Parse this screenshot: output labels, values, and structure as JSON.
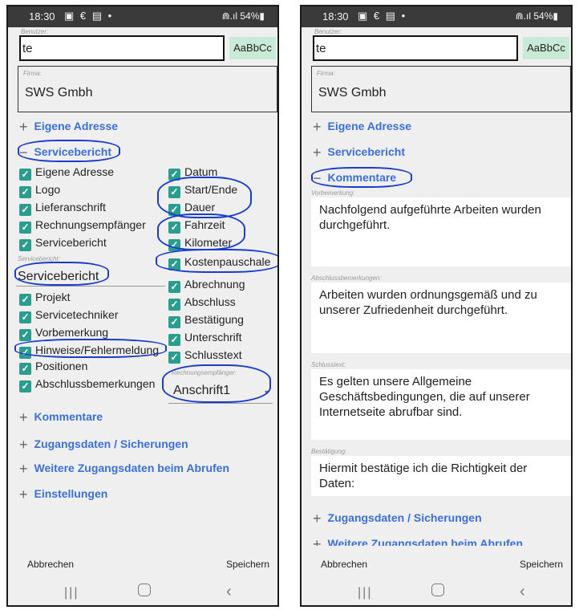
{
  "status": {
    "time": "18:30",
    "icons": "▣ € ▤ •",
    "battery": "⋒.ıl 54%▮"
  },
  "header": {
    "user_label": "Benutzer:",
    "user_value": "te",
    "style_button": "AaBbCc",
    "firma_label": "Firma:",
    "firma_value": "SWS Gmbh"
  },
  "screen1": {
    "sections": {
      "eigene": "Eigene Adresse",
      "servicebericht": "Servicebericht",
      "kommentare": "Kommentare",
      "zugang": "Zugangsdaten / Sicherungen",
      "weitere": "Weitere Zugangsdaten beim Abrufen",
      "einstellungen": "Einstellungen"
    },
    "left_checks": [
      "Eigene Adresse",
      "Logo",
      "Lieferanschrift",
      "Rechnungsempfänger",
      "Servicebericht"
    ],
    "servicebericht_label": "Servicebericht:",
    "servicebericht_value": "Servicebericht",
    "left_checks2": [
      "Projekt",
      "Servicetechniker",
      "Vorbemerkung",
      "Hinweise/Fehlermeldung",
      "Positionen",
      "Abschlussbemerkungen"
    ],
    "right_checks": [
      "Datum",
      "Start/Ende",
      "Dauer",
      "Fahrzeit",
      "Kilometer",
      "Kostenpauschale",
      "Abrechnung",
      "Abschluss",
      "Bestätigung",
      "Unterschrift",
      "Schlusstext"
    ],
    "rechnung_label": "Rechnungsempfänger:",
    "rechnung_value": "Anschrift1"
  },
  "screen2": {
    "sections": {
      "eigene": "Eigene Adresse",
      "servicebericht": "Servicebericht",
      "kommentare": "Kommentare",
      "zugang": "Zugangsdaten / Sicherungen",
      "weitere": "Weitere Zugangsdaten beim Abrufen"
    },
    "vorbemerkung_label": "Vorbemerkung:",
    "vorbemerkung_text": "Nachfolgend aufgeführte Arbeiten wurden durchgeführt.",
    "abschluss_label": "Abschlussbemerkungen:",
    "abschluss_text": "Arbeiten wurden ordnungsgemäß und zu unserer Zufriedenheit durchgeführt.",
    "schluss_label": "Schlusstext:",
    "schluss_text": "Es gelten unsere Allgemeine Geschäftsbedingungen, die auf unserer Internetseite abrufbar sind.",
    "bestaetigung_label": "Bestätigung:",
    "bestaetigung_text": "Hiermit bestätige ich die Richtigkeit der Daten:"
  },
  "footer": {
    "cancel": "Abbrechen",
    "save": "Speichern"
  },
  "navbar": {
    "recents": "|||",
    "back": "‹"
  },
  "colors": {
    "accent": "#3b6fd8",
    "check": "#2a9d8f",
    "style_button_bg": "#c9ead6",
    "annotation": "#1a3ccc"
  },
  "icons": {
    "plus": "+",
    "minus": "−",
    "check": "✓",
    "dropdown": "▾"
  }
}
